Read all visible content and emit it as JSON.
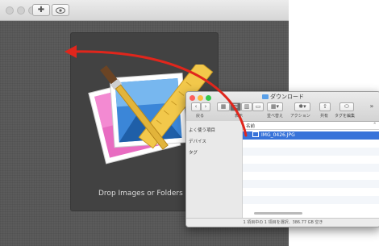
{
  "app": {
    "drop_text": "Drop Images or Folders Here",
    "toolbar": {
      "add_icon": "+",
      "preview_icon": "eye"
    }
  },
  "finder": {
    "title": "ダウンロード",
    "toolbar": {
      "back_label": "戻る",
      "view_label": "表示",
      "sort_label": "並べ替え",
      "action_label": "アクション",
      "share_label": "共有",
      "tags_label": "タグを編集"
    },
    "sidebar": {
      "favorites": "よく使う項目",
      "devices": "デバイス",
      "tags": "タグ"
    },
    "column_header": "名前",
    "files": [
      "IMG_0426.JPG"
    ],
    "status": "1 項目中の 1 項目を選択、386.77 GB 空き"
  },
  "colors": {
    "accent": "#3873d9",
    "arrow": "#e0261c"
  }
}
